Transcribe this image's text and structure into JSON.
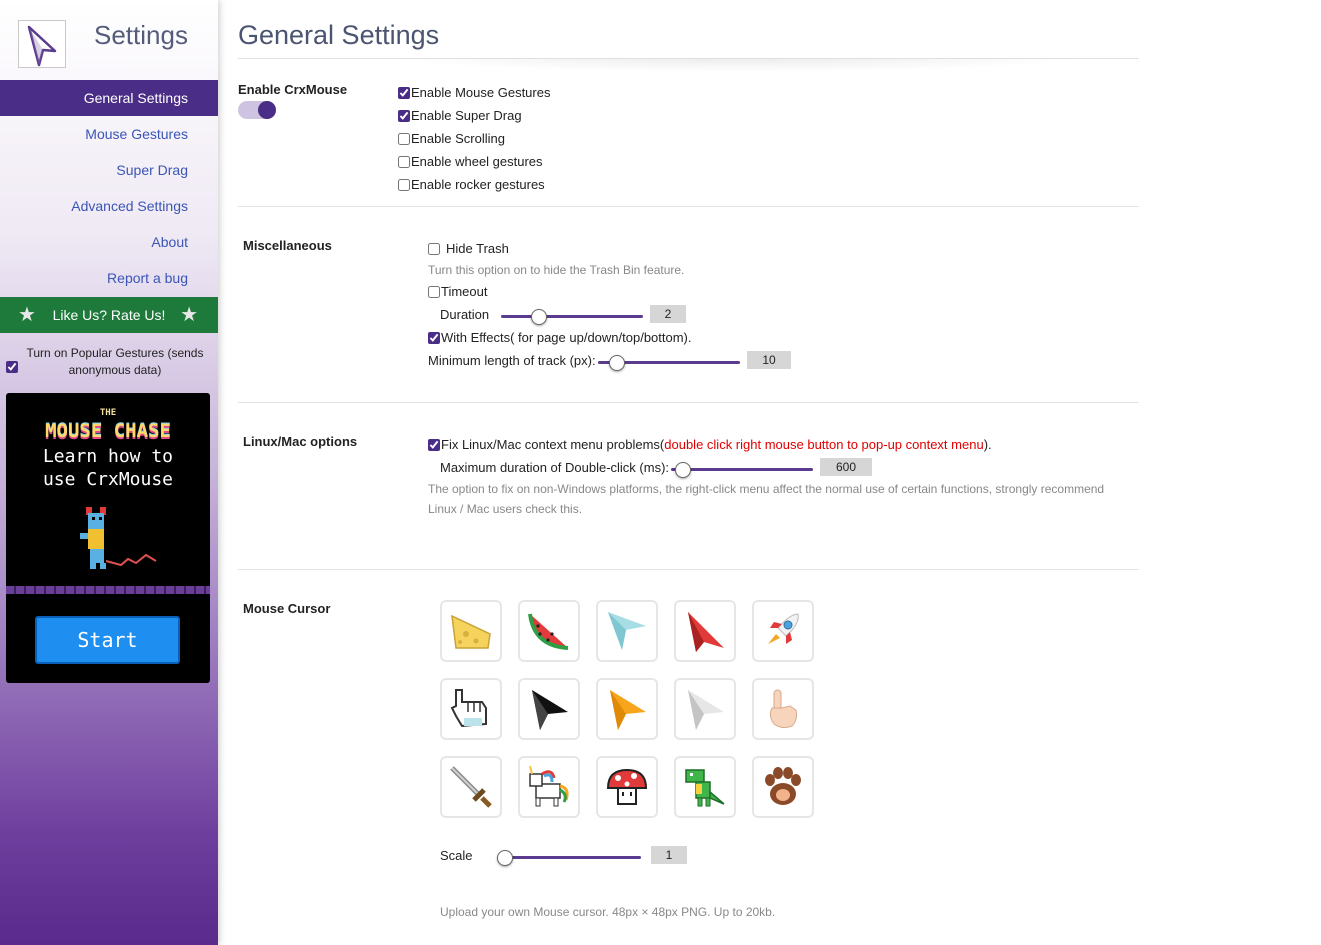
{
  "sidebar": {
    "title": "Settings",
    "nav": [
      {
        "label": "General Settings",
        "active": true
      },
      {
        "label": "Mouse Gestures",
        "active": false
      },
      {
        "label": "Super Drag",
        "active": false
      },
      {
        "label": "Advanced Settings",
        "active": false
      },
      {
        "label": "About",
        "active": false
      },
      {
        "label": "Report a bug",
        "active": false
      }
    ],
    "rate_label": "Like Us? Rate Us!",
    "popular_gestures": {
      "label": "Turn on Popular Gestures (sends anonymous data)",
      "checked": true
    },
    "promo": {
      "the": "THE",
      "title": "MOUSE CHASE",
      "subtitle_line1": "Learn how to",
      "subtitle_line2": "use CrxMouse",
      "button": "Start"
    }
  },
  "main": {
    "title": "General Settings",
    "enable_section": {
      "label": "Enable CrxMouse",
      "toggle_on": true,
      "options": [
        {
          "label": "Enable Mouse Gestures",
          "checked": true
        },
        {
          "label": "Enable Super Drag",
          "checked": true
        },
        {
          "label": "Enable Scrolling",
          "checked": false
        },
        {
          "label": "Enable wheel gestures",
          "checked": false
        },
        {
          "label": "Enable rocker gestures",
          "checked": false
        }
      ]
    },
    "misc": {
      "label": "Miscellaneous",
      "hide_trash": {
        "label": "Hide Trash",
        "checked": false
      },
      "hide_trash_hint": "Turn this option on to hide the Trash Bin feature.",
      "timeout": {
        "label": "Timeout",
        "checked": false
      },
      "duration": {
        "label": "Duration",
        "value": "2",
        "fraction": 0.25
      },
      "effects": {
        "label": "With Effects( for page up/down/top/bottom).",
        "checked": true
      },
      "min_length": {
        "label": "Minimum length of track (px):",
        "value": "10",
        "fraction": 0.1
      }
    },
    "linux": {
      "label": "Linux/Mac options",
      "fix": {
        "label": "Fix Linux/Mac context menu problems(",
        "highlight": "double click right mouse button to pop-up context menu",
        "suffix": ").",
        "checked": true
      },
      "double_click": {
        "label": "Maximum duration of Double-click (ms):",
        "value": "600",
        "fraction": 0.05
      },
      "hint": "The option to fix on non-Windows platforms, the right-click menu affect the normal use of certain functions, strongly recommend Linux / Mac users check this."
    },
    "cursor": {
      "label": "Mouse Cursor",
      "icons": [
        "cheese-icon",
        "watermelon-icon",
        "paper-plane-icon",
        "red-arrow-icon",
        "rocket-icon",
        "pixel-hand-icon",
        "black-arrow-icon",
        "orange-arrow-icon",
        "gray-arrow-icon",
        "pointing-hand-icon",
        "pixel-sword-icon",
        "unicorn-icon",
        "mushroom-icon",
        "dinosaur-icon",
        "paw-icon"
      ],
      "scale": {
        "label": "Scale",
        "value": "1",
        "fraction": 0.0
      },
      "upload_hint": "Upload your own Mouse cursor. 48px × 48px PNG. Up to 20kb."
    }
  }
}
